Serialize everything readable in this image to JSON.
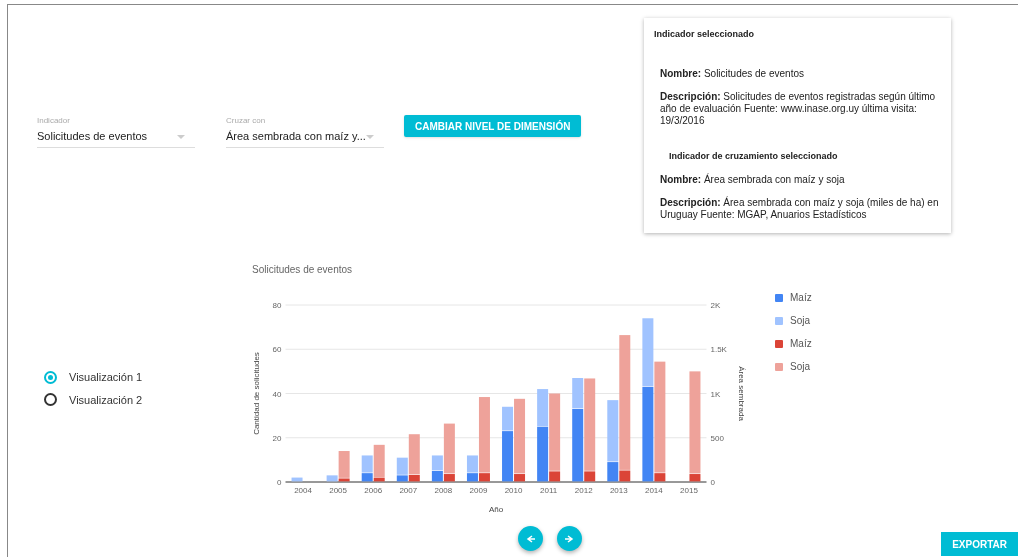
{
  "selectors": [
    {
      "label": "Indicador",
      "value": "Solicitudes de eventos"
    },
    {
      "label": "Cruzar con",
      "value": "Área sembrada con maíz y..."
    }
  ],
  "change_button": "CAMBIAR NIVEL DE DIMENSIÓN",
  "info_card": {
    "title": "Indicador seleccionado",
    "name_label": "Nombre:",
    "name": "Solicitudes de eventos",
    "description_label": "Descripción:",
    "description": "Solicitudes de eventos registradas según último año de evaluación Fuente: www.inase.org.uy última visita: 19/3/2016",
    "cross_title": "Indicador de cruzamiento seleccionado",
    "cross_name_label": "Nombre:",
    "cross_name": "Área sembrada con maíz y soja",
    "cross_description_label": "Descripción:",
    "cross_description": "Área sembrada con maíz y soja (miles de ha) en Uruguay Fuente: MGAP, Anuarios Estadísticos"
  },
  "visualizations": [
    {
      "label": "Visualización 1",
      "selected": true
    },
    {
      "label": "Visualización 2",
      "selected": false
    }
  ],
  "chart": {
    "chart_data": {
      "type": "bar",
      "title": "Solicitudes de eventos",
      "xlabel": "Año",
      "ylabel": "Cantidad de solicitudes",
      "y2label": "Área sembrada",
      "stacked": true,
      "grid": true,
      "legend": "right",
      "categories": [
        "2004",
        "2005",
        "2006",
        "2007",
        "2008",
        "2009",
        "2010",
        "2011",
        "2012",
        "2013",
        "2014",
        "2015"
      ],
      "ylim": [
        0,
        80
      ],
      "yticks": [
        0,
        20,
        40,
        60,
        80
      ],
      "y2lim": [
        0,
        2000
      ],
      "y2ticks": [
        {
          "value": 0,
          "label": "0"
        },
        {
          "value": 500,
          "label": "500"
        },
        {
          "value": 1000,
          "label": "1K"
        },
        {
          "value": 1500,
          "label": "1.5K"
        },
        {
          "value": 2000,
          "label": "2K"
        }
      ],
      "series": [
        {
          "name": "Maíz",
          "color": "#4285f4",
          "values": [
            0,
            0,
            4,
            3,
            5,
            4,
            23,
            25,
            33,
            9,
            43,
            null
          ]
        },
        {
          "name": "Soja",
          "color": "#a0c3ff",
          "values": [
            2,
            3,
            8,
            8,
            7,
            8,
            11,
            17,
            14,
            28,
            31,
            null
          ]
        },
        {
          "name": "Maíz",
          "color": "#db4437",
          "axis": "y2",
          "values": [
            null,
            40,
            50,
            80,
            90,
            100,
            90,
            120,
            120,
            130,
            100,
            90
          ]
        },
        {
          "name": "Soja",
          "color": "#eea29a",
          "axis": "y2",
          "values": [
            null,
            310,
            370,
            460,
            570,
            860,
            850,
            880,
            1050,
            1530,
            1260,
            1160
          ]
        }
      ]
    }
  },
  "export_button": "EXPORTAR"
}
